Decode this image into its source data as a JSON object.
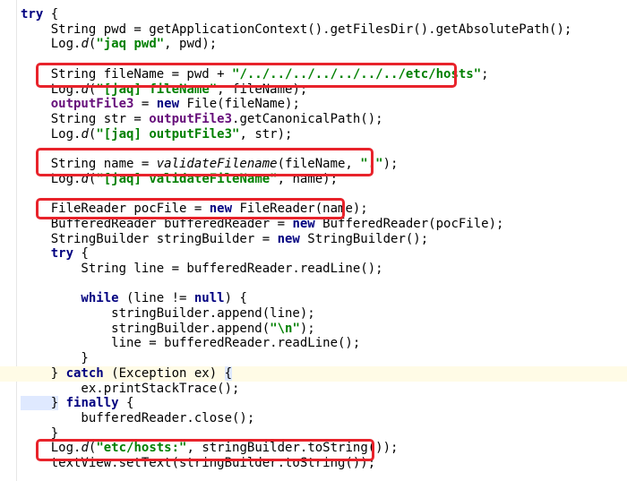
{
  "code_lines": [
    [
      {
        "k": "kw",
        "t": "try"
      },
      {
        "k": "n",
        "t": " {"
      }
    ],
    [
      {
        "k": "n",
        "t": "    String pwd = getApplicationContext().getFilesDir().getAbsolutePath();"
      }
    ],
    [
      {
        "k": "n",
        "t": "    Log."
      },
      {
        "k": "mth",
        "t": "d"
      },
      {
        "k": "n",
        "t": "("
      },
      {
        "k": "str",
        "t": "\"jaq pwd\""
      },
      {
        "k": "n",
        "t": ", pwd);"
      }
    ],
    [],
    [
      {
        "k": "n",
        "t": "    String fileName = pwd + "
      },
      {
        "k": "str",
        "t": "\"/../../../../../../../etc/hosts\""
      },
      {
        "k": "n",
        "t": ";"
      }
    ],
    [
      {
        "k": "n",
        "t": "    Log."
      },
      {
        "k": "mth",
        "t": "d"
      },
      {
        "k": "n",
        "t": "("
      },
      {
        "k": "str",
        "t": "\"[jaq] fileName\""
      },
      {
        "k": "n",
        "t": ", fileName);"
      }
    ],
    [
      {
        "k": "fld",
        "t": "    outputFile3"
      },
      {
        "k": "n",
        "t": " = "
      },
      {
        "k": "kw",
        "t": "new"
      },
      {
        "k": "n",
        "t": " File(fileName);"
      }
    ],
    [
      {
        "k": "n",
        "t": "    String str = "
      },
      {
        "k": "fld",
        "t": "outputFile3"
      },
      {
        "k": "n",
        "t": ".getCanonicalPath();"
      }
    ],
    [
      {
        "k": "n",
        "t": "    Log."
      },
      {
        "k": "mth",
        "t": "d"
      },
      {
        "k": "n",
        "t": "("
      },
      {
        "k": "str",
        "t": "\"[jaq] outputFile3\""
      },
      {
        "k": "n",
        "t": ", str);"
      }
    ],
    [],
    [
      {
        "k": "n",
        "t": "    String name = "
      },
      {
        "k": "mth",
        "t": "validateFilename"
      },
      {
        "k": "n",
        "t": "(fileName, "
      },
      {
        "k": "str",
        "t": "\".\""
      },
      {
        "k": "n",
        "t": ");"
      }
    ],
    [
      {
        "k": "n",
        "t": "    Log."
      },
      {
        "k": "mth",
        "t": "d"
      },
      {
        "k": "n",
        "t": "("
      },
      {
        "k": "str",
        "t": "\"[jaq] validateFileName\""
      },
      {
        "k": "n",
        "t": ", name);"
      }
    ],
    [],
    [
      {
        "k": "n",
        "t": "    FileReader pocFile = "
      },
      {
        "k": "kw",
        "t": "new"
      },
      {
        "k": "n",
        "t": " FileReader(name);"
      }
    ],
    [
      {
        "k": "n",
        "t": "    BufferedReader bufferedReader = "
      },
      {
        "k": "kw",
        "t": "new"
      },
      {
        "k": "n",
        "t": " BufferedReader(pocFile);"
      }
    ],
    [
      {
        "k": "n",
        "t": "    StringBuilder stringBuilder = "
      },
      {
        "k": "kw",
        "t": "new"
      },
      {
        "k": "n",
        "t": " StringBuilder();"
      }
    ],
    [
      {
        "k": "kw",
        "t": "    try"
      },
      {
        "k": "n",
        "t": " {"
      }
    ],
    [
      {
        "k": "n",
        "t": "        String line = bufferedReader.readLine();"
      }
    ],
    [],
    [
      {
        "k": "kw",
        "t": "        while"
      },
      {
        "k": "n",
        "t": " (line != "
      },
      {
        "k": "kw",
        "t": "null"
      },
      {
        "k": "n",
        "t": ") {"
      }
    ],
    [
      {
        "k": "n",
        "t": "            stringBuilder.append(line);"
      }
    ],
    [
      {
        "k": "n",
        "t": "            stringBuilder.append("
      },
      {
        "k": "str",
        "t": "\"\\n\""
      },
      {
        "k": "n",
        "t": ");"
      }
    ],
    [
      {
        "k": "n",
        "t": "            line = bufferedReader.readLine();"
      }
    ],
    [
      {
        "k": "n",
        "t": "        }"
      }
    ],
    [
      {
        "k": "n",
        "t": "    } "
      },
      {
        "k": "kw",
        "t": "catch"
      },
      {
        "k": "n",
        "t": " (Exception ex) "
      },
      {
        "k": "bh",
        "t": "{"
      }
    ],
    [
      {
        "k": "n",
        "t": "        ex.printStackTrace();"
      }
    ],
    [
      {
        "k": "bh",
        "t": "    }"
      },
      {
        "k": "n",
        "t": " "
      },
      {
        "k": "kw",
        "t": "finally"
      },
      {
        "k": "n",
        "t": " {"
      }
    ],
    [
      {
        "k": "n",
        "t": "        bufferedReader.close();"
      }
    ],
    [
      {
        "k": "n",
        "t": "    }"
      }
    ],
    [
      {
        "k": "n",
        "t": "    Log."
      },
      {
        "k": "mth",
        "t": "d"
      },
      {
        "k": "n",
        "t": "("
      },
      {
        "k": "str",
        "t": "\"etc/hosts:\""
      },
      {
        "k": "n",
        "t": ", stringBuilder.toString());"
      }
    ],
    [
      {
        "k": "n",
        "t": "    textView.setText(stringBuilder.toString());"
      }
    ]
  ],
  "highlighted_line": 24,
  "colors": {
    "keyword": "#000080",
    "string": "#008000",
    "field": "#660e7a",
    "box": "#e8232b",
    "current_line": "#fffbe6"
  }
}
